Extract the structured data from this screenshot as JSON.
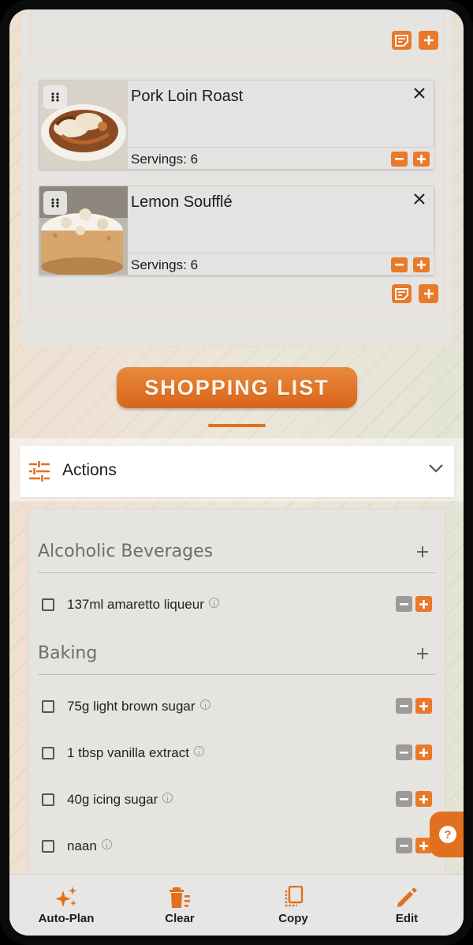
{
  "colors": {
    "accent": "#e87a2a",
    "accent_dark": "#d9641b",
    "card_bg": "#e6e4e1",
    "nav_bg": "#e7e6e4",
    "muted_button": "#9b9b9b"
  },
  "meal_plan": {
    "recipes": [
      {
        "title": "Pork Loin Roast",
        "servings": "Servings: 6",
        "image_icon": "roast-photo"
      },
      {
        "title": "Lemon Soufflé",
        "servings": "Servings: 6",
        "image_icon": "souffle-photo"
      }
    ]
  },
  "shopping_list": {
    "banner": "SHOPPING LIST",
    "actions_label": "Actions",
    "categories": [
      {
        "name": "Alcoholic Beverages",
        "items": [
          "137ml amaretto liqueur"
        ]
      },
      {
        "name": "Baking",
        "items": [
          "75g light brown sugar",
          "1 tbsp vanilla extract",
          "40g icing sugar",
          "naan"
        ]
      }
    ]
  },
  "nav": {
    "items": [
      {
        "label": "Auto-Plan",
        "icon": "sparkles-icon"
      },
      {
        "label": "Clear",
        "icon": "trash-icon"
      },
      {
        "label": "Copy",
        "icon": "copy-icon"
      },
      {
        "label": "Edit",
        "icon": "pencil-icon"
      }
    ]
  }
}
